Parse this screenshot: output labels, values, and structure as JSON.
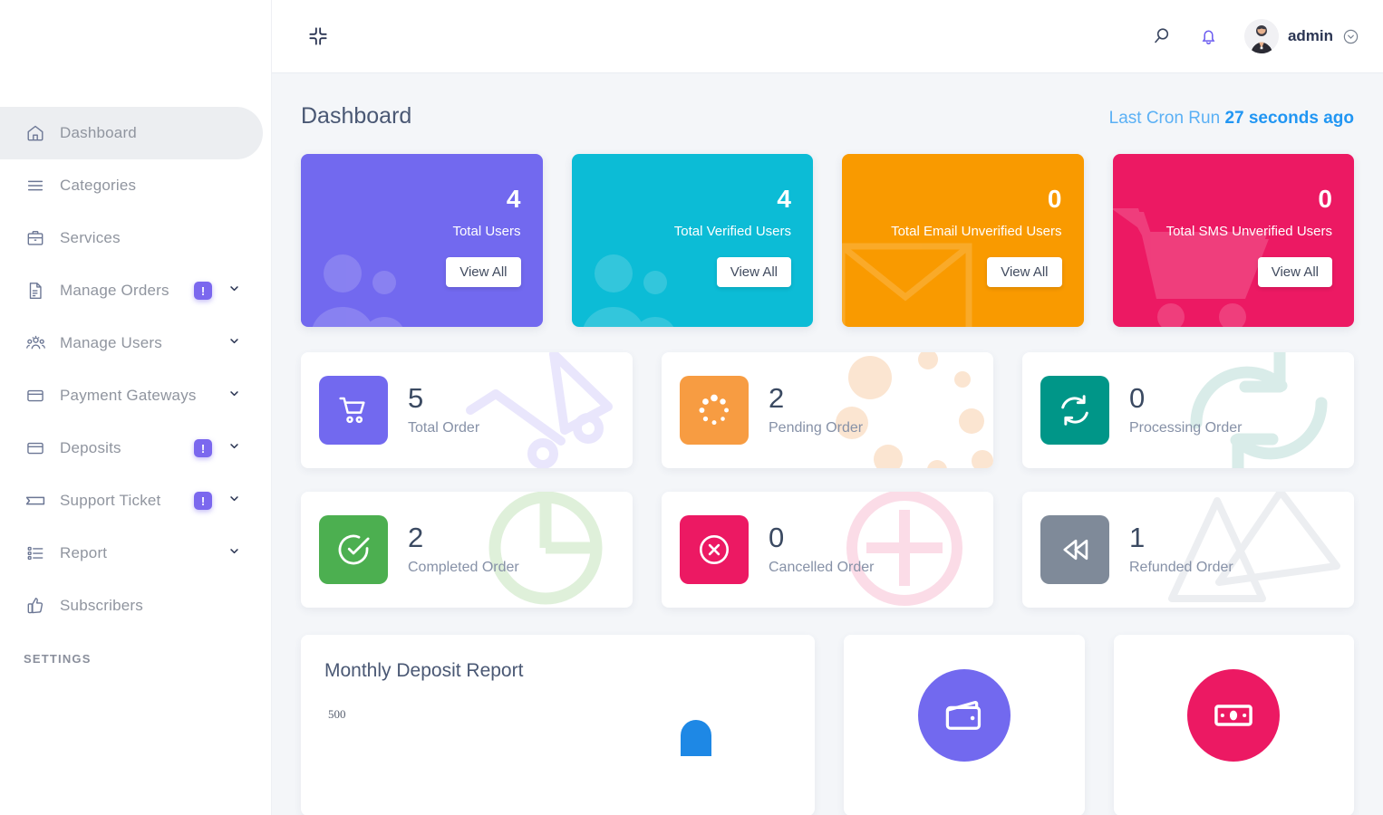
{
  "sidebar": {
    "items": [
      {
        "label": "Dashboard",
        "icon": "home-icon",
        "active": true,
        "badge": null,
        "caret": false
      },
      {
        "label": "Categories",
        "icon": "list-icon",
        "active": false,
        "badge": null,
        "caret": false
      },
      {
        "label": "Services",
        "icon": "briefcase-icon",
        "active": false,
        "badge": null,
        "caret": false
      },
      {
        "label": "Manage Orders",
        "icon": "document-icon",
        "active": false,
        "badge": "!",
        "caret": true
      },
      {
        "label": "Manage Users",
        "icon": "users-icon",
        "active": false,
        "badge": null,
        "caret": true
      },
      {
        "label": "Payment Gateways",
        "icon": "card-icon",
        "active": false,
        "badge": null,
        "caret": true
      },
      {
        "label": "Deposits",
        "icon": "card-icon",
        "active": false,
        "badge": "!",
        "caret": true
      },
      {
        "label": "Support Ticket",
        "icon": "ticket-icon",
        "active": false,
        "badge": "!",
        "caret": true
      },
      {
        "label": "Report",
        "icon": "report-list-icon",
        "active": false,
        "badge": null,
        "caret": true
      },
      {
        "label": "Subscribers",
        "icon": "thumbs-up-icon",
        "active": false,
        "badge": null,
        "caret": false
      }
    ],
    "section_label": "SETTINGS"
  },
  "topbar": {
    "collapse_icon": "compress-icon",
    "search_icon": "search-icon",
    "notification_icon": "bell-icon",
    "avatar": "avatar",
    "username": "admin",
    "user_caret_icon": "chevron-down-circle-icon"
  },
  "header": {
    "title": "Dashboard",
    "cron_prefix": "Last Cron Run ",
    "cron_value": "27 seconds ago"
  },
  "stat_cards": [
    {
      "value": "4",
      "label": "Total Users",
      "button": "View All",
      "color": "#7269ef",
      "icon": "users-group-icon"
    },
    {
      "value": "4",
      "label": "Total Verified Users",
      "button": "View All",
      "color": "#0cbcd6",
      "icon": "users-group-icon"
    },
    {
      "value": "0",
      "label": "Total Email Unverified Users",
      "button": "View All",
      "color": "#f99a00",
      "icon": "envelope-icon"
    },
    {
      "value": "0",
      "label": "Total SMS Unverified Users",
      "button": "View All",
      "color": "#ec1963",
      "icon": "shopping-cart-icon"
    }
  ],
  "order_cards": [
    {
      "value": "5",
      "label": "Total Order",
      "color": "#7269ef",
      "icon": "cart-icon",
      "bg_icon": "trolley-bg"
    },
    {
      "value": "2",
      "label": "Pending Order",
      "color": "#f79c42",
      "icon": "spinner-icon",
      "bg_icon": "dots-bg"
    },
    {
      "value": "0",
      "label": "Processing Order",
      "color": "#009688",
      "icon": "refresh-icon",
      "bg_icon": "refresh-bg"
    },
    {
      "value": "2",
      "label": "Completed Order",
      "color": "#4caf50",
      "icon": "check-circle-icon",
      "bg_icon": "pie-bg"
    },
    {
      "value": "0",
      "label": "Cancelled Order",
      "color": "#ec1963",
      "icon": "x-circle-icon",
      "bg_icon": "plus-bg"
    },
    {
      "value": "1",
      "label": "Refunded Order",
      "color": "#7f8a99",
      "icon": "rewind-icon",
      "bg_icon": "triangles-bg"
    }
  ],
  "deposit_panel": {
    "title": "Monthly Deposit Report"
  },
  "chart_data": {
    "type": "bar",
    "title": "Monthly Deposit Report",
    "categories": [
      ""
    ],
    "values": [
      500
    ],
    "ytick_labels": [
      "500"
    ],
    "xlabel": "",
    "ylabel": "",
    "ylim": [
      0,
      500
    ],
    "grid": false,
    "legend": "none",
    "series_color": "#1e88e5"
  },
  "side_panels": [
    {
      "icon": "wallet-icon",
      "color": "#7269ef"
    },
    {
      "icon": "money-note-icon",
      "color": "#ec1963"
    }
  ]
}
